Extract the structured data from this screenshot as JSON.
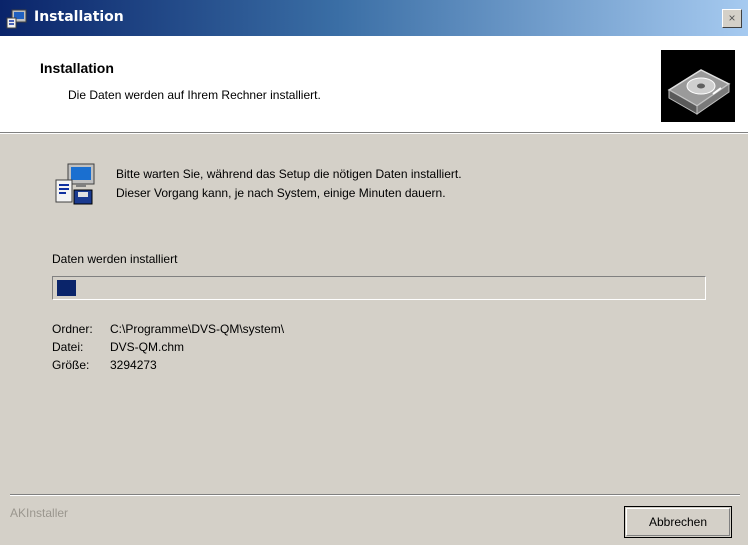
{
  "window": {
    "title": "Installation",
    "close_symbol": "×",
    "title_icon": "installer-icon"
  },
  "header": {
    "title": "Installation",
    "subtitle": "Die Daten werden auf Ihrem Rechner installiert.",
    "icon": "harddisk-icon"
  },
  "info": {
    "icon": "setup-computer-icon",
    "line1": "Bitte warten Sie, während das Setup die nötigen Daten installiert.",
    "line2": "Dieser Vorgang kann, je nach System, einige Minuten dauern."
  },
  "progress": {
    "label": "Daten werden installiert",
    "fraction": 0.03
  },
  "details": {
    "folder_label": "Ordner:",
    "folder_value": "C:\\Programme\\DVS-QM\\system\\",
    "file_label": "Datei:",
    "file_value": "DVS-QM.chm",
    "size_label": "Größe:",
    "size_value": "3294273"
  },
  "footer": {
    "brand": "AKInstaller",
    "cancel_label": "Abbrechen"
  }
}
